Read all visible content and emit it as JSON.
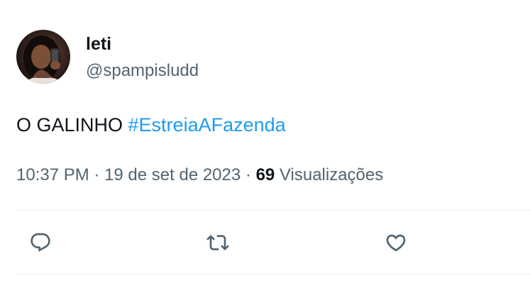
{
  "tweet": {
    "author": {
      "display_name": "leti",
      "handle": "@spampisludd"
    },
    "text": {
      "plain": "O GALINHO ",
      "hashtag": "#EstreiaAFazenda"
    },
    "meta": {
      "time": "10:37 PM",
      "separator": " · ",
      "date": "19 de set de 2023",
      "views_count": "69",
      "views_label": " Visualizações"
    },
    "actions": {
      "reply_icon": "reply-icon",
      "retweet_icon": "retweet-icon",
      "like_icon": "like-icon"
    }
  },
  "colors": {
    "text_primary": "#0f1419",
    "text_secondary": "#536471",
    "hashtag": "#1d9bf0",
    "divider": "#eff3f4"
  }
}
